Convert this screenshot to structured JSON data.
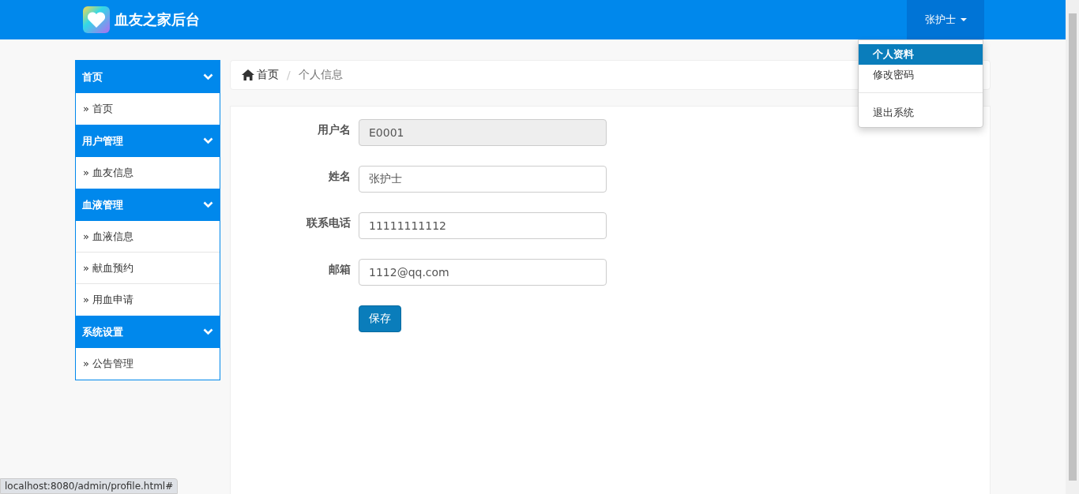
{
  "navbar": {
    "brand": "血友之家后台",
    "user": "张护士",
    "user_menu": {
      "expanded": true,
      "items": [
        {
          "label": "个人资料",
          "selected": true,
          "kind": "item"
        },
        {
          "label": "修改密码",
          "selected": false,
          "kind": "item"
        },
        {
          "kind": "divider"
        },
        {
          "label": "退出系统",
          "selected": false,
          "kind": "item"
        }
      ]
    }
  },
  "sidebar": {
    "groups": [
      {
        "title": "首页",
        "items": [
          "» 首页"
        ]
      },
      {
        "title": "用户管理",
        "items": [
          "» 血友信息"
        ]
      },
      {
        "title": "血液管理",
        "items": [
          "» 血液信息",
          "» 献血预约",
          "» 用血申请"
        ]
      },
      {
        "title": "系统设置",
        "items": [
          "» 公告管理"
        ]
      }
    ]
  },
  "breadcrumb": {
    "home": "首页",
    "separator": "/",
    "current": "个人信息"
  },
  "form": {
    "fields": [
      {
        "label": "用户名",
        "value": "E0001",
        "disabled": true
      },
      {
        "label": "姓名",
        "value": "张护士",
        "disabled": false
      },
      {
        "label": "联系电话",
        "value": "11111111112",
        "disabled": false
      },
      {
        "label": "邮箱",
        "value": "1112@qq.com",
        "disabled": false
      }
    ],
    "submit": "保存"
  },
  "status_bar": {
    "url": "localhost:8080/admin/profile.html#"
  }
}
